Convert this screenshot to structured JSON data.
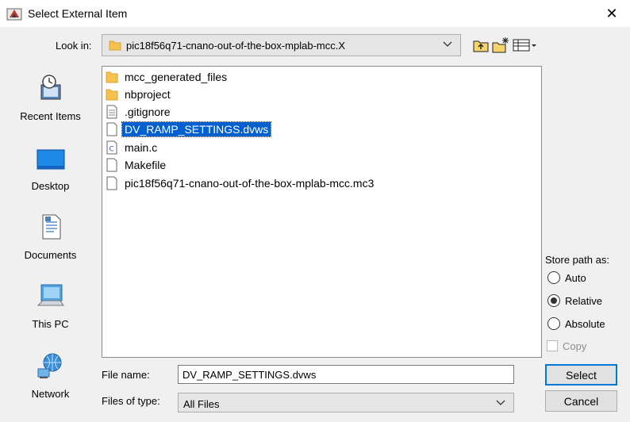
{
  "window": {
    "title": "Select External Item",
    "close_glyph": "✕"
  },
  "lookin": {
    "label": "Look in:",
    "value": "pic18f56q71-cnano-out-of-the-box-mplab-mcc.X"
  },
  "places": [
    {
      "label": "Recent Items",
      "icon": "recent-items-icon"
    },
    {
      "label": "Desktop",
      "icon": "desktop-icon"
    },
    {
      "label": "Documents",
      "icon": "documents-icon"
    },
    {
      "label": "This PC",
      "icon": "this-pc-icon"
    },
    {
      "label": "Network",
      "icon": "network-icon"
    }
  ],
  "files": [
    {
      "name": "mcc_generated_files",
      "type": "folder"
    },
    {
      "name": "nbproject",
      "type": "folder"
    },
    {
      "name": ".gitignore",
      "type": "text"
    },
    {
      "name": "DV_RAMP_SETTINGS.dvws",
      "type": "file",
      "selected": true
    },
    {
      "name": "main.c",
      "type": "c"
    },
    {
      "name": "Makefile",
      "type": "file"
    },
    {
      "name": "pic18f56q71-cnano-out-of-the-box-mplab-mcc.mc3",
      "type": "file"
    }
  ],
  "store_path": {
    "title": "Store path as:",
    "options": [
      {
        "label": "Auto",
        "checked": false
      },
      {
        "label": "Relative",
        "checked": true
      },
      {
        "label": "Absolute",
        "checked": false
      }
    ],
    "copy_label": "Copy"
  },
  "filename": {
    "label": "File name:",
    "value": "DV_RAMP_SETTINGS.dvws"
  },
  "filetype": {
    "label": "Files of type:",
    "value": "All Files"
  },
  "buttons": {
    "select": "Select",
    "cancel": "Cancel"
  },
  "colors": {
    "selection": "#0060d0",
    "folder": "#f6c24e",
    "default_button_border": "#0078d7"
  }
}
